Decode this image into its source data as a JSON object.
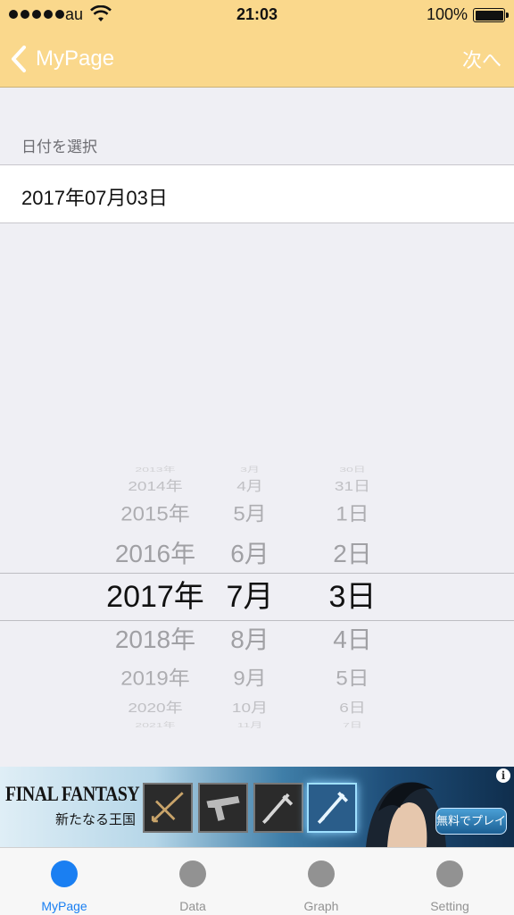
{
  "status_bar": {
    "carrier": "au",
    "time": "21:03",
    "battery": "100%"
  },
  "nav": {
    "back_label": "MyPage",
    "next_label": "次へ"
  },
  "section": {
    "header": "日付を選択",
    "selected_date": "2017年07月03日"
  },
  "picker": {
    "years": [
      "2013年",
      "2014年",
      "2015年",
      "2016年",
      "2017年",
      "2018年",
      "2019年",
      "2020年",
      "2021年"
    ],
    "months": [
      "3月",
      "4月",
      "5月",
      "6月",
      "7月",
      "8月",
      "9月",
      "10月",
      "11月"
    ],
    "days": [
      "30日",
      "31日",
      "1日",
      "2日",
      "3日",
      "4日",
      "5日",
      "6日",
      "7日"
    ],
    "selected_index": 4
  },
  "ad": {
    "title": "FINAL FANTASY XV",
    "subtitle": "新たなる王国",
    "cta": "無料でプレイ",
    "info": "i"
  },
  "tabs": [
    {
      "label": "MyPage",
      "active": true
    },
    {
      "label": "Data",
      "active": false
    },
    {
      "label": "Graph",
      "active": false
    },
    {
      "label": "Setting",
      "active": false
    }
  ],
  "colors": {
    "nav_bar": "#fad88c",
    "tab_active": "#1a7ff2",
    "tab_inactive": "#929292"
  }
}
